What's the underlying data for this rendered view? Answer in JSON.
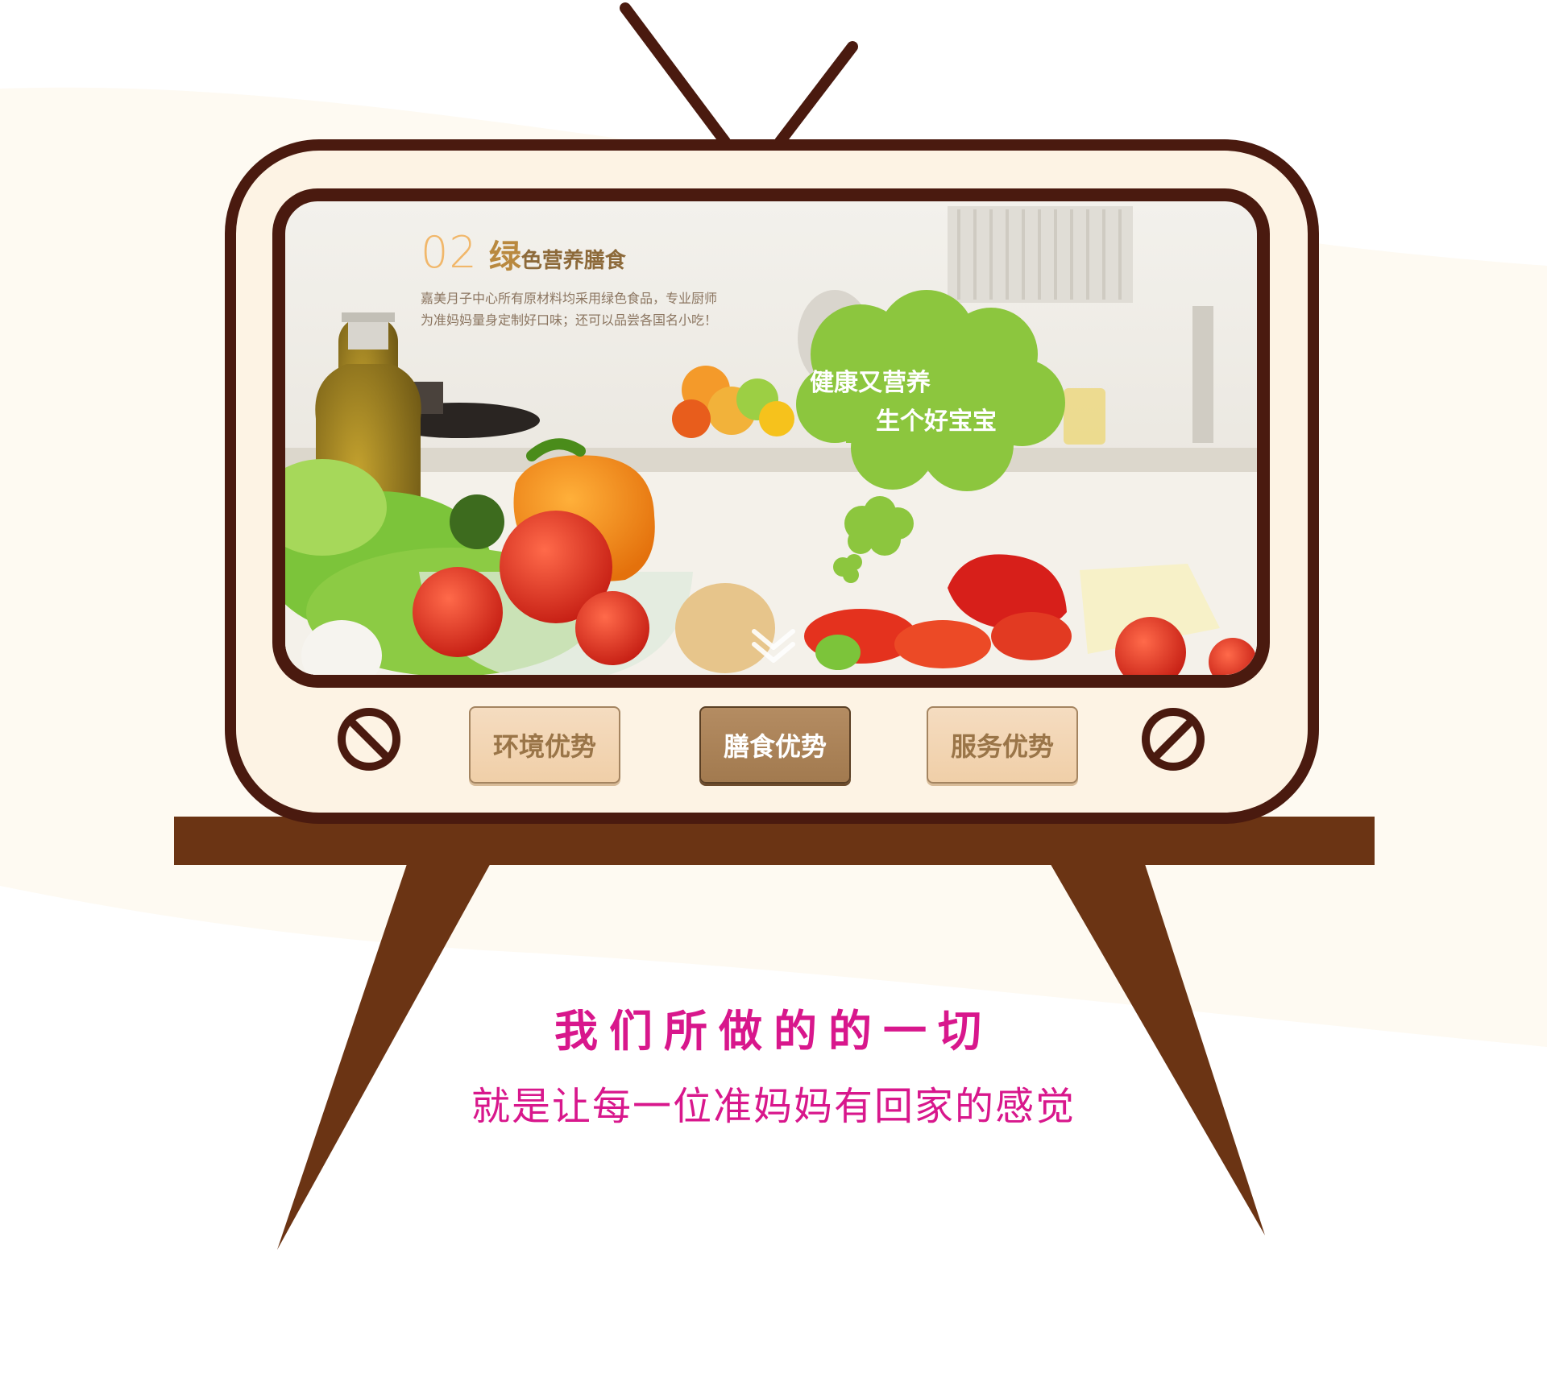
{
  "screen": {
    "number": "02",
    "title_lead": "绿",
    "title_rest": "色营养膳食",
    "description": "嘉美月子中心所有原材料均采用绿色食品，专业厨师为准妈妈量身定制好口味；还可以品尝各国名小吃！"
  },
  "bubble": {
    "line1": "健康又营养",
    "line2": "生个好宝宝"
  },
  "tabs": [
    {
      "label": "环境优势",
      "active": false
    },
    {
      "label": "膳食优势",
      "active": true
    },
    {
      "label": "服务优势",
      "active": false
    }
  ],
  "slogan": {
    "line1": "我们所做的的一切",
    "line2": "就是让每一位准妈妈有回家的感觉"
  },
  "colors": {
    "frame_dark": "#4a1a0f",
    "frame_cream": "#fdf3e4",
    "stand_brown": "#6b3414",
    "bubble_green": "#8cc63e",
    "slogan_pink": "#d8178c",
    "tab_active": "#a27a4f",
    "tab_inactive": "#f2d4b0"
  },
  "icons": {
    "down_arrow": "double-chevron-down-icon",
    "knob": "tv-knob-icon"
  }
}
